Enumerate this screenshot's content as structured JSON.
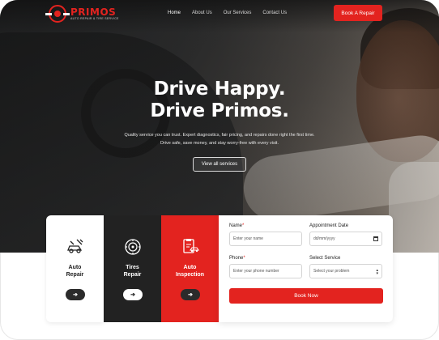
{
  "brand": {
    "name": "PRIMOS",
    "tagline": "AUTO REPAIR & TIRE SERVICE",
    "accent": "#e3231f"
  },
  "nav": {
    "items": [
      {
        "label": "Home",
        "active": true
      },
      {
        "label": "About Us",
        "active": false
      },
      {
        "label": "Our Services",
        "active": false
      },
      {
        "label": "Contact Us",
        "active": false
      }
    ],
    "cta_label": "Book A Repair"
  },
  "hero": {
    "headline_line1": "Drive Happy.",
    "headline_line2": "Drive Primos.",
    "subtext": "Quality service you can trust. Expert diagnostics, fair pricing, and repairs done right the first time. Drive safe, save money, and stay worry-free with every visit.",
    "button_label": "View all services"
  },
  "services": [
    {
      "title_line1": "Auto",
      "title_line2": "Repair",
      "icon": "car-repair-icon",
      "arrow": "➔"
    },
    {
      "title_line1": "Tires",
      "title_line2": "Repair",
      "icon": "tire-icon",
      "arrow": "➔"
    },
    {
      "title_line1": "Auto",
      "title_line2": "Inspection",
      "icon": "inspection-clipboard-icon",
      "arrow": "➔"
    }
  ],
  "form": {
    "name_label": "Name",
    "name_placeholder": "Enter your name",
    "date_label": "Appointment Date",
    "date_placeholder": "dd/mm/yyyy",
    "phone_label": "Phone",
    "phone_placeholder": "Enter your phone number",
    "service_label": "Select Service",
    "service_selected": "Select your problem",
    "submit_label": "Book Now"
  }
}
